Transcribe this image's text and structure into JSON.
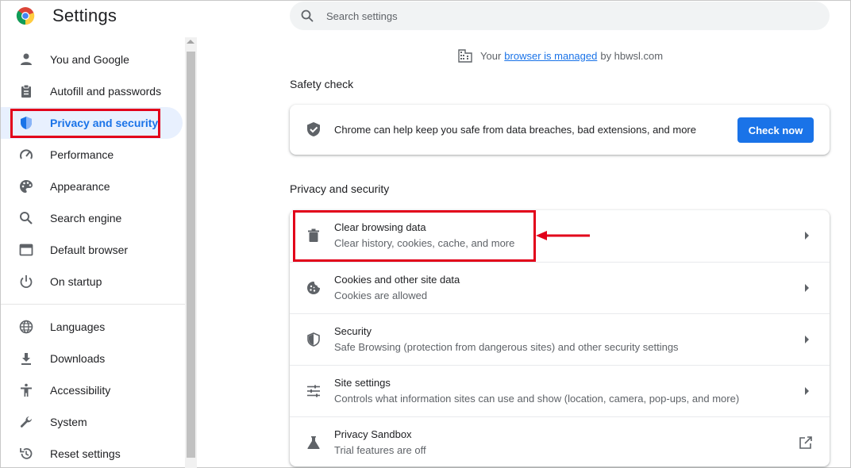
{
  "app": {
    "title": "Settings"
  },
  "search": {
    "placeholder": "Search settings"
  },
  "sidebar": {
    "items": [
      {
        "label": "You and Google",
        "icon": "person-icon"
      },
      {
        "label": "Autofill and passwords",
        "icon": "clipboard-icon"
      },
      {
        "label": "Privacy and security",
        "icon": "shield-icon",
        "active": true
      },
      {
        "label": "Performance",
        "icon": "speedometer-icon"
      },
      {
        "label": "Appearance",
        "icon": "palette-icon"
      },
      {
        "label": "Search engine",
        "icon": "search-icon"
      },
      {
        "label": "Default browser",
        "icon": "browser-icon"
      },
      {
        "label": "On startup",
        "icon": "power-icon"
      },
      {
        "label": "Languages",
        "icon": "globe-icon"
      },
      {
        "label": "Downloads",
        "icon": "download-icon"
      },
      {
        "label": "Accessibility",
        "icon": "accessibility-icon"
      },
      {
        "label": "System",
        "icon": "wrench-icon"
      },
      {
        "label": "Reset settings",
        "icon": "reset-icon"
      }
    ]
  },
  "managed": {
    "prefix": "Your",
    "link": "browser is managed",
    "suffix": "by hbwsl.com",
    "icon": "building-icon"
  },
  "safety_check": {
    "title": "Safety check",
    "text": "Chrome can help keep you safe from data breaches, bad extensions, and more",
    "button": "Check now",
    "icon": "shield-check-icon"
  },
  "privacy": {
    "title": "Privacy and security",
    "rows": [
      {
        "title": "Clear browsing data",
        "subtitle": "Clear history, cookies, cache, and more",
        "icon": "trash-icon"
      },
      {
        "title": "Cookies and other site data",
        "subtitle": "Cookies are allowed",
        "icon": "cookie-icon"
      },
      {
        "title": "Security",
        "subtitle": "Safe Browsing (protection from dangerous sites) and other security settings",
        "icon": "shield-icon"
      },
      {
        "title": "Site settings",
        "subtitle": "Controls what information sites can use and show (location, camera, pop-ups, and more)",
        "icon": "sliders-icon"
      },
      {
        "title": "Privacy Sandbox",
        "subtitle": "Trial features are off",
        "icon": "flask-icon"
      }
    ]
  },
  "colors": {
    "accent": "#1a73e8",
    "annotation": "#e2001a",
    "active_bg": "#e8f0fe"
  }
}
